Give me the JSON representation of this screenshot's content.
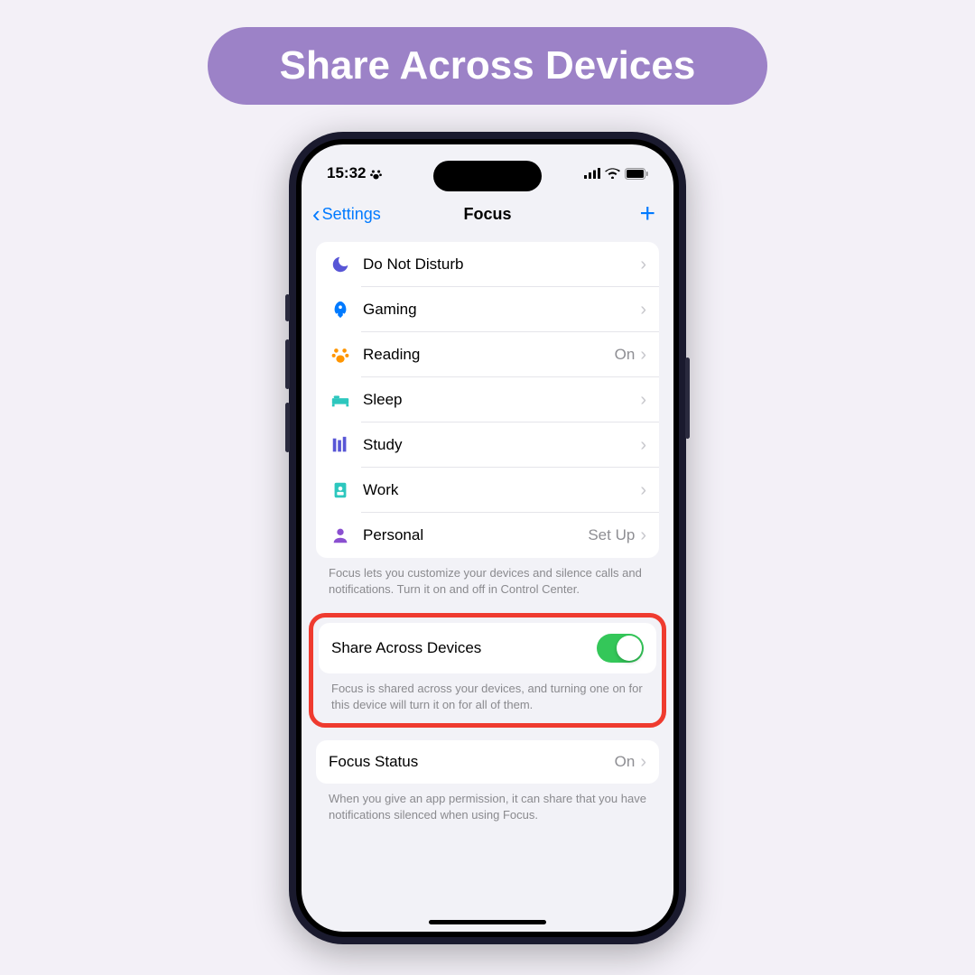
{
  "banner": {
    "title": "Share Across Devices"
  },
  "statusBar": {
    "time": "15:32"
  },
  "nav": {
    "back": "Settings",
    "title": "Focus"
  },
  "focusList": {
    "items": [
      {
        "label": "Do Not Disturb",
        "value": ""
      },
      {
        "label": "Gaming",
        "value": ""
      },
      {
        "label": "Reading",
        "value": "On"
      },
      {
        "label": "Sleep",
        "value": ""
      },
      {
        "label": "Study",
        "value": ""
      },
      {
        "label": "Work",
        "value": ""
      },
      {
        "label": "Personal",
        "value": "Set Up"
      }
    ],
    "footer": "Focus lets you customize your devices and silence calls and notifications. Turn it on and off in Control Center."
  },
  "shareSection": {
    "label": "Share Across Devices",
    "footer": "Focus is shared across your devices, and turning one on for this device will turn it on for all of them."
  },
  "statusSection": {
    "label": "Focus Status",
    "value": "On",
    "footer": "When you give an app permission, it can share that you have notifications silenced when using Focus."
  }
}
